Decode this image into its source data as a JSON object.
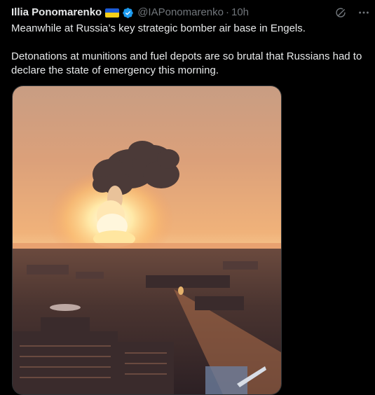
{
  "author": {
    "name": "Illia Ponomarenko",
    "handle": "@IAPonomarenko",
    "separator": "·",
    "time": "10h",
    "flag_colors": [
      "#1c5bd6",
      "#f7cf1a"
    ],
    "verified_color": "#1d9bf0"
  },
  "icons": {
    "grok": "slash-circle-icon",
    "more": "more-horizontal-icon"
  },
  "tweet": {
    "paragraphs": [
      "Meanwhile at Russia’s key strategic bomber air base in Engels.",
      "Detonations at munitions and fuel depots are so brutal that Russians had to declare the state of emergency this morning."
    ]
  },
  "colors": {
    "background": "#000000",
    "text": "#e7e9ea",
    "muted": "#71767b",
    "border": "#2f3336"
  }
}
